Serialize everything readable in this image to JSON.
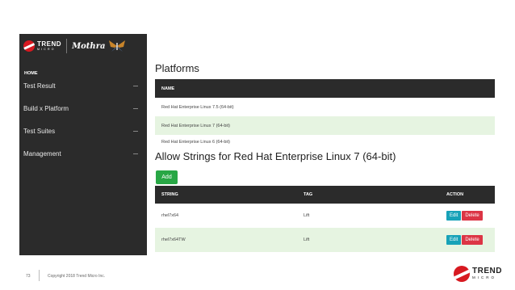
{
  "sidebar": {
    "brand": {
      "logo_main": "TREND",
      "logo_sub": "MICRO",
      "app_name": "Mothra"
    },
    "home_label": "HOME",
    "items": [
      {
        "label": "Test Result"
      },
      {
        "label": "Build x Platform"
      },
      {
        "label": "Test Suites"
      },
      {
        "label": "Management"
      }
    ]
  },
  "platforms": {
    "title": "Platforms",
    "header": "NAME",
    "rows": [
      "Red Hat Enterprise Linux 7.5 (64-bit)",
      "Red Hat Enterprise Linux 7 (64-bit)",
      "Red Hat Enterprise Linux 6 (64-bit)"
    ]
  },
  "allow": {
    "title": "Allow Strings for Red Hat Enterprise Linux 7 (64-bit)",
    "add_label": "Add",
    "columns": {
      "string": "STRING",
      "tag": "TAG",
      "action": "ACTION"
    },
    "rows": [
      {
        "string": "rhel7x64",
        "tag": "Lift",
        "edit": "Edit",
        "delete": "Delete"
      },
      {
        "string": "rhel7x64TW",
        "tag": "Lift",
        "edit": "Edit",
        "delete": "Delete"
      }
    ]
  },
  "footer": {
    "page_number": "73",
    "copyright": "Copyright 2018 Trend Micro Inc.",
    "logo_main": "TREND",
    "logo_sub": "MICRO"
  },
  "colors": {
    "sidebar_bg": "#2b2b2b",
    "table_header_bg": "#2b2b2b",
    "row_highlight": "#e6f4e1",
    "add_button": "#28a745",
    "edit_button": "#17a2b8",
    "delete_button": "#dc3545",
    "brand_red": "#d71920"
  },
  "icons": [
    "trend-micro-logo-icon",
    "moth-icon"
  ]
}
